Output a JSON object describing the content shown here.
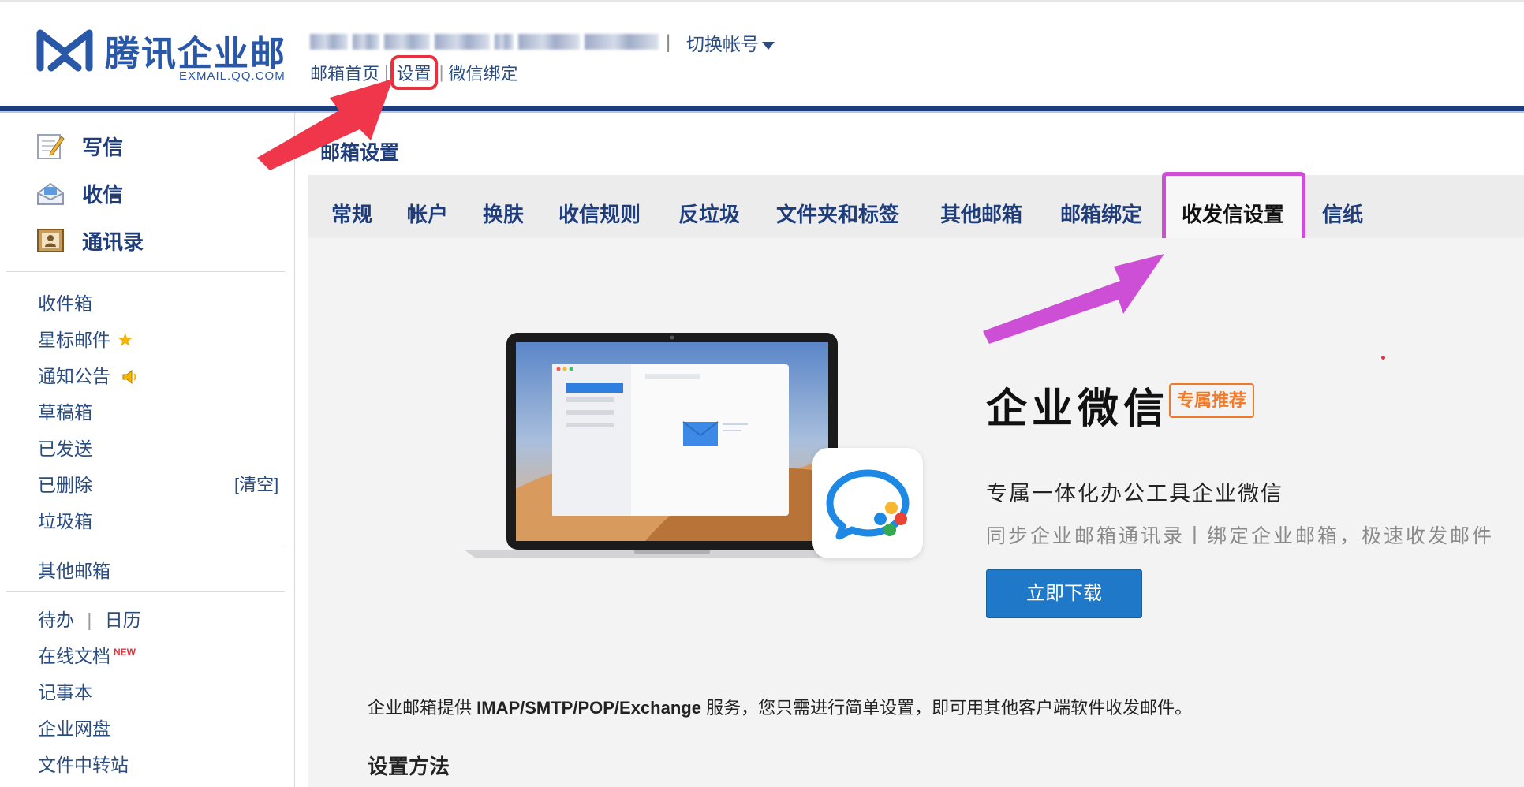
{
  "brand": {
    "name": "腾讯企业邮",
    "domain": "EXMAIL.QQ.COM",
    "color": "#2a58a8"
  },
  "account": {
    "switch_label": "切换帐号"
  },
  "top_links": {
    "home": "邮箱首页",
    "settings": "设置",
    "wechat_bind": "微信绑定"
  },
  "sidebar": {
    "main": [
      {
        "label": "写信",
        "icon": "compose-icon"
      },
      {
        "label": "收信",
        "icon": "inbox-tray-icon"
      },
      {
        "label": "通讯录",
        "icon": "contacts-icon"
      }
    ],
    "folders": [
      {
        "label": "收件箱"
      },
      {
        "label": "星标邮件",
        "icon": "star-icon",
        "glyph": "★"
      },
      {
        "label": "通知公告",
        "icon": "speaker-icon",
        "glyph": "🔈"
      },
      {
        "label": "草稿箱"
      },
      {
        "label": "已发送"
      },
      {
        "label": "已删除",
        "action": "[清空]"
      },
      {
        "label": "垃圾箱"
      }
    ],
    "other_mail": "其他邮箱",
    "tools": {
      "todo": "待办",
      "calendar": "日历",
      "docs": "在线文档",
      "docs_badge": "NEW",
      "notes": "记事本",
      "disk": "企业网盘",
      "transfer": "文件中转站"
    }
  },
  "main": {
    "title": "邮箱设置",
    "tabs": [
      {
        "label": "常规"
      },
      {
        "label": "帐户"
      },
      {
        "label": "换肤"
      },
      {
        "label": "收信规则"
      },
      {
        "label": "反垃圾"
      },
      {
        "label": "文件夹和标签"
      },
      {
        "label": "其他邮箱"
      },
      {
        "label": "邮箱绑定"
      },
      {
        "label": "收发信设置",
        "active": true
      },
      {
        "label": "信纸"
      }
    ],
    "promo": {
      "title": "企业微信",
      "badge": "专属推荐",
      "desc": "专属一体化办公工具企业微信",
      "sub": "同步企业邮箱通讯录丨绑定企业邮箱，极速收发邮件",
      "button": "立即下载"
    },
    "intro_prefix": "企业邮箱提供 ",
    "intro_bold": "IMAP/SMTP/POP/Exchange",
    "intro_suffix": " 服务，您只需进行简单设置，即可用其他客户端软件收发邮件。",
    "method_title": "设置方法"
  },
  "colors": {
    "nav_blue": "#1f3d7a",
    "link_blue": "#2b4c80",
    "accent_orange": "#f07a2a",
    "button_blue": "#1f78c8",
    "annotation_red": "#f0364a",
    "annotation_magenta": "#cc4fd6"
  }
}
